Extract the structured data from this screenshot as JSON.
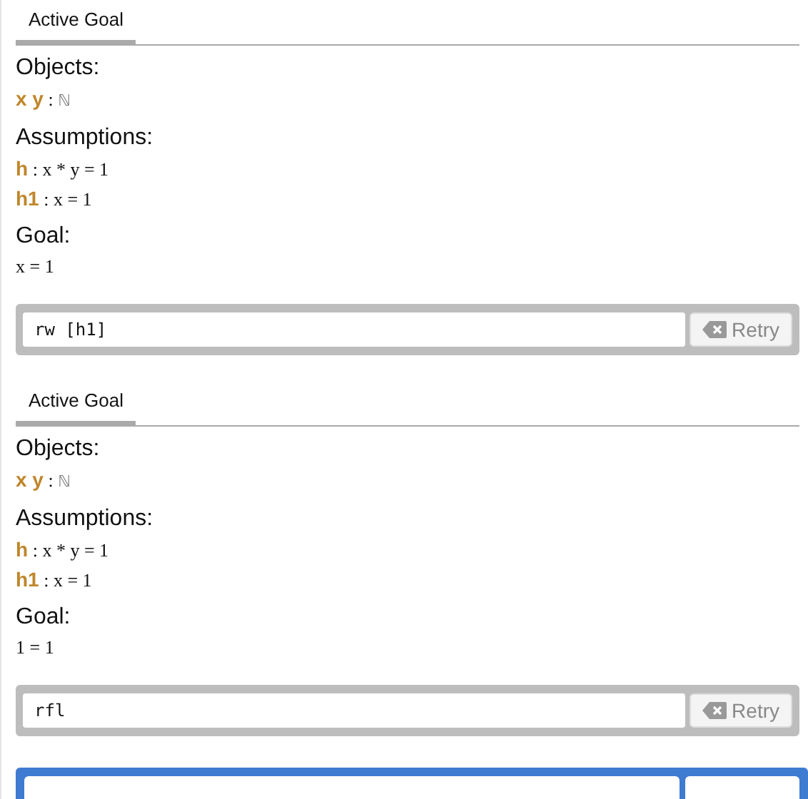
{
  "goals": [
    {
      "tabs": [
        {
          "label": "Active Goal",
          "selected": true
        }
      ],
      "objects_heading": "Objects:",
      "objects": [
        {
          "names": "x y",
          "separator": ":",
          "type": "ℕ"
        }
      ],
      "assumptions_heading": "Assumptions:",
      "assumptions": [
        {
          "name": "h",
          "separator": ":",
          "statement": "x * y = 1"
        },
        {
          "name": "h1",
          "separator": ":",
          "statement": "x = 1"
        }
      ],
      "goal_heading": "Goal:",
      "goal": "x = 1",
      "command": "rw [h1]",
      "retry_label": "Retry"
    },
    {
      "tabs": [
        {
          "label": "Active Goal",
          "selected": true
        }
      ],
      "objects_heading": "Objects:",
      "objects": [
        {
          "names": "x y",
          "separator": ":",
          "type": "ℕ"
        }
      ],
      "assumptions_heading": "Assumptions:",
      "assumptions": [
        {
          "name": "h",
          "separator": ":",
          "statement": "x * y = 1"
        },
        {
          "name": "h1",
          "separator": ":",
          "statement": "x = 1"
        }
      ],
      "goal_heading": "Goal:",
      "goal": "1 = 1",
      "command": "rfl",
      "retry_label": "Retry"
    }
  ]
}
